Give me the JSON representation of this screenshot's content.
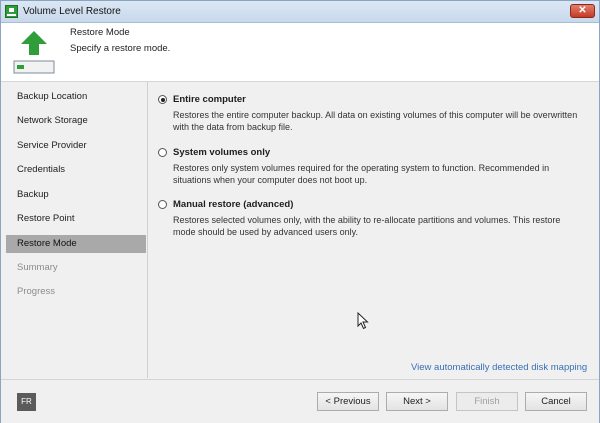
{
  "window": {
    "title": "Volume Level Restore",
    "close_label": "✕"
  },
  "header": {
    "title": "Restore Mode",
    "subtitle": "Specify a restore mode."
  },
  "sidebar": {
    "items": [
      {
        "label": "Backup Location",
        "state": "normal"
      },
      {
        "label": "Network Storage",
        "state": "normal"
      },
      {
        "label": "Service Provider",
        "state": "normal"
      },
      {
        "label": "Credentials",
        "state": "normal"
      },
      {
        "label": "Backup",
        "state": "normal"
      },
      {
        "label": "Restore Point",
        "state": "normal"
      },
      {
        "label": "Restore Mode",
        "state": "active"
      },
      {
        "label": "Summary",
        "state": "disabled"
      },
      {
        "label": "Progress",
        "state": "disabled"
      }
    ]
  },
  "main": {
    "options": [
      {
        "label": "Entire computer",
        "checked": true,
        "description": "Restores the entire computer backup. All data on existing volumes of this computer will be overwritten with the data from backup file."
      },
      {
        "label": "System volumes only",
        "checked": false,
        "description": "Restores only system volumes required for the operating system to function. Recommended in situations when your computer does not boot up."
      },
      {
        "label": "Manual restore (advanced)",
        "checked": false,
        "description": "Restores selected volumes only, with the ability to re-allocate partitions and volumes. This restore mode should be used by advanced users only."
      }
    ],
    "link_text": "View automatically detected disk mapping"
  },
  "footer": {
    "language_badge": "FR",
    "previous_label": "< Previous",
    "next_label": "Next >",
    "finish_label": "Finish",
    "cancel_label": "Cancel"
  },
  "colors": {
    "accent_green": "#2f9e3a",
    "link_blue": "#3a6fb5",
    "active_nav": "#a9a9a9"
  }
}
